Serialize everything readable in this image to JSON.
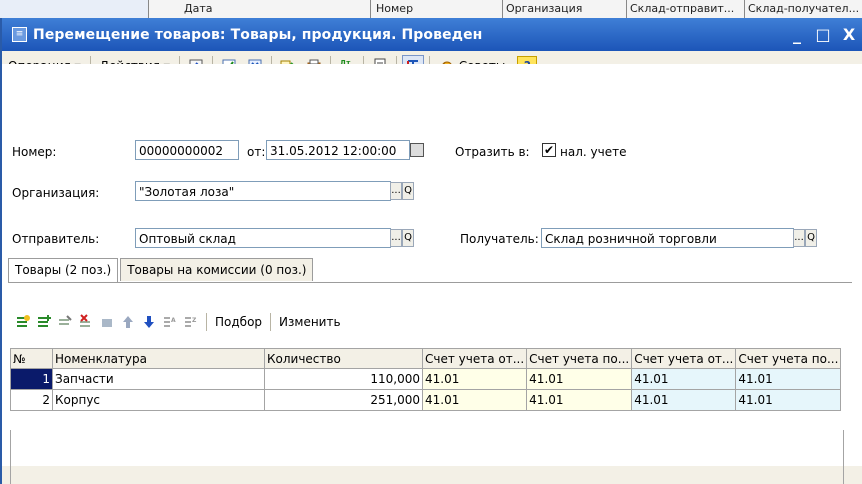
{
  "background_window": {
    "columns": [
      "Дата",
      "Номер",
      "Организация",
      "Склад-отправит...",
      "Склад-получател..."
    ]
  },
  "window": {
    "title": "Перемещение товаров: Товары, продукция. Проведен",
    "buttons": {
      "minimize": "_",
      "maximize": "□",
      "close": "X"
    }
  },
  "toolbar": {
    "operation": "Операция ▾",
    "actions": "Действия ▾",
    "tips": "Советы",
    "help": "?",
    "dt_kt": "Дт Кт"
  },
  "form": {
    "number_label": "Номер:",
    "number_value": "00000000002",
    "date_label": "от:",
    "date_value": "31.05.2012 12:00:00",
    "reflect_label": "Отразить в:",
    "tax_checked": "✔",
    "tax_label": "нал. учете",
    "org_label": "Организация:",
    "org_value": "\"Золотая лоза\"",
    "sender_label": "Отправитель:",
    "sender_value": "Оптовый склад",
    "receiver_label": "Получатель:",
    "receiver_value": "Склад розничной торговли",
    "select_btn": "...",
    "open_btn": "Q"
  },
  "tabs": [
    {
      "label": "Товары (2 поз.)"
    },
    {
      "label": "Товары на комиссии (0 поз.)"
    }
  ],
  "subtoolbar": {
    "pick": "Подбор",
    "edit": "Изменить"
  },
  "table": {
    "headers": [
      "№",
      "Номенклатура",
      "Количество",
      "Счет учета от...",
      "Счет учета по...",
      "Счет учета от...",
      "Счет учета по..."
    ],
    "rows": [
      {
        "n": "1",
        "name": "Запчасти",
        "qty": "110,000",
        "a1": "41.01",
        "a2": "41.01",
        "a3": "41.01",
        "a4": "41.01"
      },
      {
        "n": "2",
        "name": "Корпус",
        "qty": "251,000",
        "a1": "41.01",
        "a2": "41.01",
        "a3": "41.01",
        "a4": "41.01"
      }
    ]
  }
}
